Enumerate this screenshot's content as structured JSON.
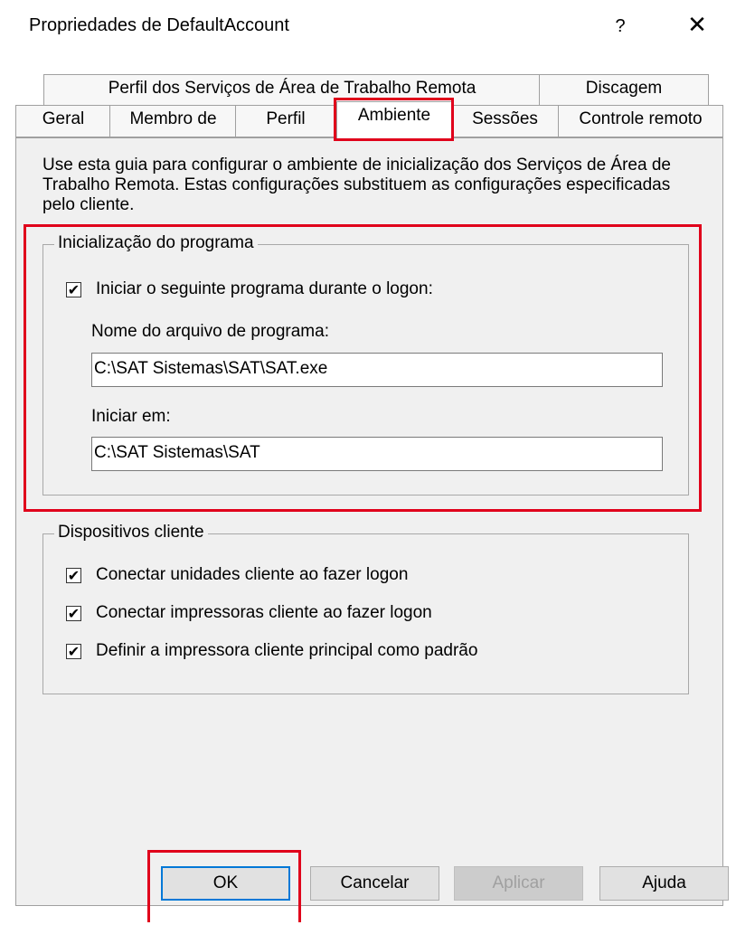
{
  "window": {
    "title": "Propriedades de DefaultAccount",
    "help_label": "?",
    "close_label": "✕"
  },
  "tabs": {
    "row1": [
      {
        "label": "Perfil dos Serviços de Área de Trabalho Remota"
      },
      {
        "label": "Discagem"
      }
    ],
    "row2": [
      {
        "label": "Geral"
      },
      {
        "label": "Membro de"
      },
      {
        "label": "Perfil"
      },
      {
        "label": "Ambiente",
        "active": true
      },
      {
        "label": "Sessões"
      },
      {
        "label": "Controle remoto"
      }
    ]
  },
  "description": "Use esta guia para configurar o ambiente de inicialização dos Serviços de Área de Trabalho Remota. Estas configurações substituem as configurações especificadas pelo cliente.",
  "program_startup": {
    "legend": "Inicialização do programa",
    "start_program": {
      "label": "Iniciar o seguinte programa durante o logon:",
      "checked": true
    },
    "program_file_label": "Nome do arquivo de programa:",
    "program_file_value": "C:\\SAT Sistemas\\SAT\\SAT.exe",
    "start_in_label": "Iniciar em:",
    "start_in_value": "C:\\SAT Sistemas\\SAT"
  },
  "client_devices": {
    "legend": "Dispositivos cliente",
    "options": [
      {
        "label": "Conectar unidades cliente ao fazer logon",
        "checked": true
      },
      {
        "label": "Conectar impressoras cliente ao fazer logon",
        "checked": true
      },
      {
        "label": "Definir a impressora cliente principal como padrão",
        "checked": true
      }
    ]
  },
  "check_glyph": "✔",
  "buttons": {
    "ok": "OK",
    "cancel": "Cancelar",
    "apply": "Aplicar",
    "help": "Ajuda"
  },
  "colors": {
    "highlight": "#e0001b",
    "focus": "#0078d7"
  }
}
